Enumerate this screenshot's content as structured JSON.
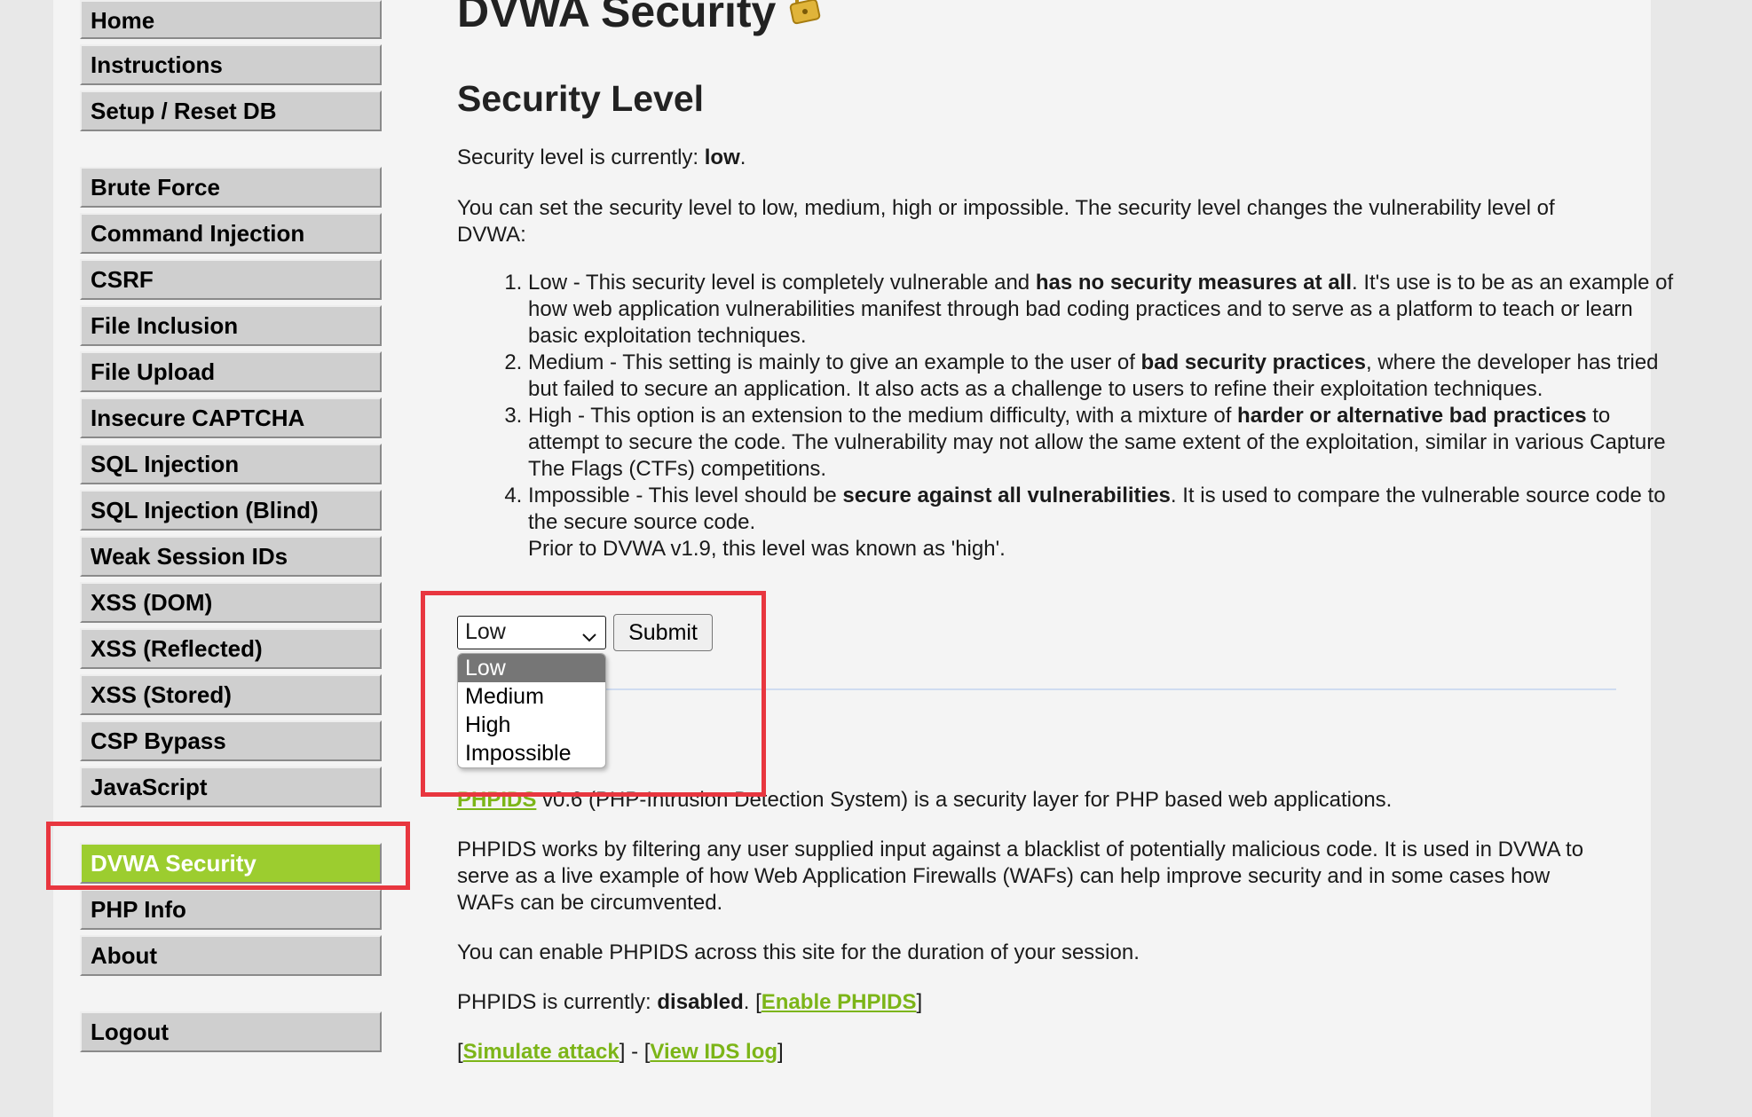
{
  "sidebar": {
    "group1": [
      {
        "label": "Home"
      },
      {
        "label": "Instructions"
      },
      {
        "label": "Setup / Reset DB"
      }
    ],
    "group2": [
      {
        "label": "Brute Force"
      },
      {
        "label": "Command Injection"
      },
      {
        "label": "CSRF"
      },
      {
        "label": "File Inclusion"
      },
      {
        "label": "File Upload"
      },
      {
        "label": "Insecure CAPTCHA"
      },
      {
        "label": "SQL Injection"
      },
      {
        "label": "SQL Injection (Blind)"
      },
      {
        "label": "Weak Session IDs"
      },
      {
        "label": "XSS (DOM)"
      },
      {
        "label": "XSS (Reflected)"
      },
      {
        "label": "XSS (Stored)"
      },
      {
        "label": "CSP Bypass"
      },
      {
        "label": "JavaScript"
      }
    ],
    "group3": [
      {
        "label": "DVWA Security",
        "selected": true
      },
      {
        "label": "PHP Info"
      },
      {
        "label": "About"
      }
    ],
    "group4": [
      {
        "label": "Logout"
      }
    ],
    "selected_color": "#9ccd2f"
  },
  "main": {
    "title": "DVWA Security",
    "title_icon": "lock-icon",
    "section_title": "Security Level",
    "current_level_prefix": "Security level is currently: ",
    "current_level": "low",
    "current_level_suffix": ".",
    "intro": "You can set the security level to low, medium, high or impossible. The security level changes the vulnerability level of DVWA:",
    "levels": {
      "low": {
        "lead": "Low - This security level is completely vulnerable and ",
        "bold": "has no security measures at all",
        "tail": ". It's use is to be as an example of how web application vulnerabilities manifest through bad coding practices and to serve as a platform to teach or learn basic exploitation techniques."
      },
      "medium": {
        "lead": "Medium - This setting is mainly to give an example to the user of ",
        "bold": "bad security practices",
        "tail": ", where the developer has tried but failed to secure an application. It also acts as a challenge to users to refine their exploitation techniques."
      },
      "high": {
        "lead": "High - This option is an extension to the medium difficulty, with a mixture of ",
        "bold": "harder or alternative bad practices",
        "tail": " to attempt to secure the code. The vulnerability may not allow the same extent of the exploitation, similar in various Capture The Flags (CTFs) competitions."
      },
      "impossible": {
        "lead": "Impossible - This level should be ",
        "bold": "secure against all vulnerabilities",
        "tail": ". It is used to compare the vulnerable source code to the secure source code.",
        "note": "Prior to DVWA v1.9, this level was known as 'high'."
      }
    },
    "form": {
      "selected_value": "Low",
      "submit_label": "Submit",
      "options": [
        "Low",
        "Medium",
        "High",
        "Impossible"
      ],
      "highlighted_option": "Low"
    },
    "phpids": {
      "link_text": "PHPIDS",
      "desc_tail": " v0.6 (PHP-Intrusion Detection System) is a security layer for PHP based web applications.",
      "works": "PHPIDS works by filtering any user supplied input against a blacklist of potentially malicious code. It is used in DVWA to serve as a live example of how Web Application Firewalls (WAFs) can help improve security and in some cases how WAFs can be circumvented.",
      "enable_note": "You can enable PHPIDS across this site for the duration of your session.",
      "status_prefix": "PHPIDS is currently: ",
      "status_value": "disabled",
      "status_suffix": ". [",
      "enable_link": "Enable PHPIDS",
      "close_bracket": "]",
      "open_bracket": "[",
      "simulate_link": "Simulate attack",
      "separator": "] - [",
      "view_log_link": "View IDS log",
      "end_bracket": "]",
      "link_color": "#7cb518"
    }
  },
  "annotations": {
    "color": "#e8363f"
  }
}
